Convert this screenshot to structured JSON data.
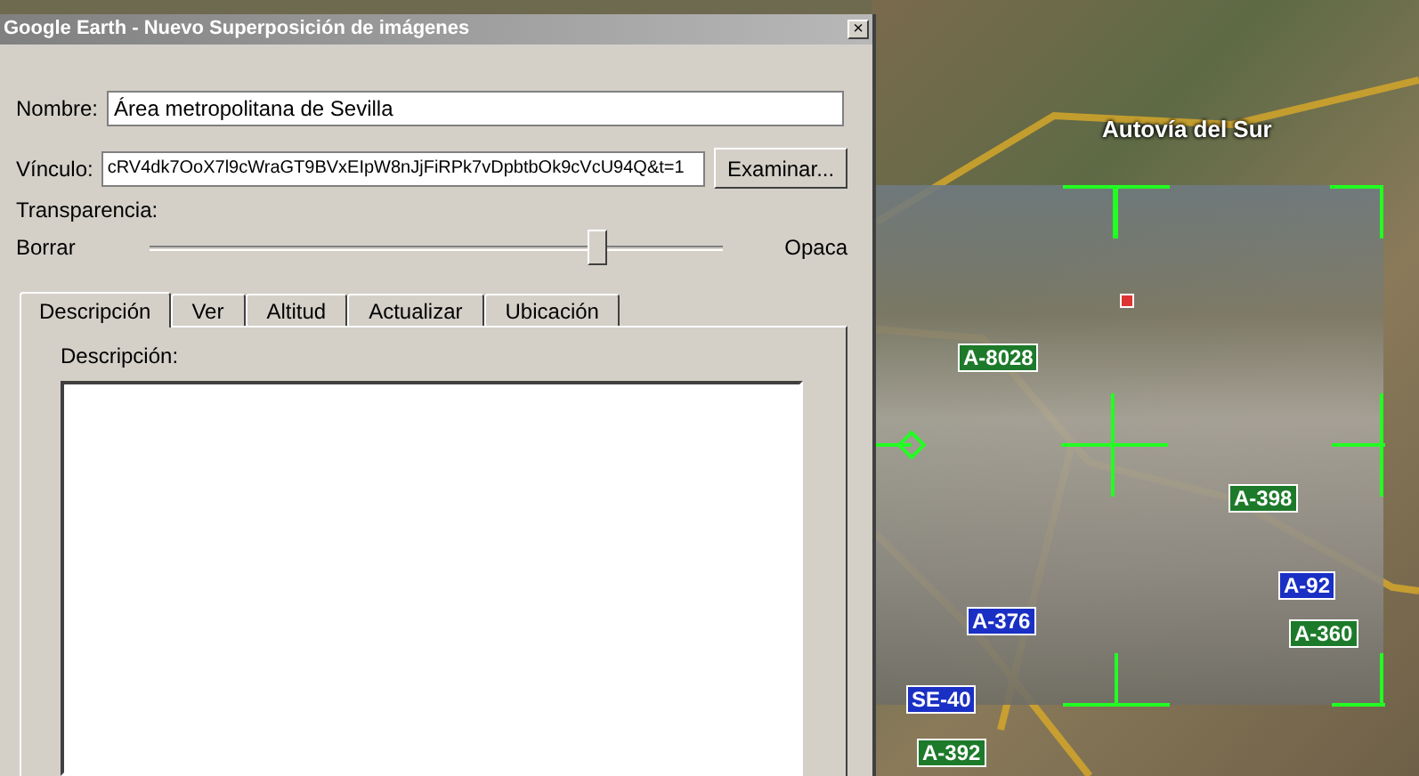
{
  "window": {
    "title": "Google Earth - Nuevo Superposición de imágenes",
    "close": "×"
  },
  "form": {
    "name_label": "Nombre:",
    "name_value": "Área metropolitana de Sevilla",
    "link_label": "Vínculo:",
    "link_value": "cRV4dk7OoX7l9cWraGT9BVxEIpW8nJjFiRPk7vDpbtbOk9cVcU94Q&t=1",
    "browse_button": "Examinar...",
    "transparency_label": "Transparencia:",
    "slider": {
      "min_label": "Borrar",
      "max_label": "Opaca",
      "level": 0.78
    }
  },
  "tabs": [
    {
      "label": "Descripción",
      "selected": true
    },
    {
      "label": "Ver",
      "selected": false
    },
    {
      "label": "Altitud",
      "selected": false
    },
    {
      "label": "Actualizar",
      "selected": false
    },
    {
      "label": "Ubicación",
      "selected": false
    }
  ],
  "description": {
    "label": "Descripción:"
  },
  "map": {
    "road_name": "Autovía del Sur",
    "shields": [
      {
        "label": "A-8028",
        "color": "#1d7a2a"
      },
      {
        "label": "A-398",
        "color": "#1d7a2a"
      },
      {
        "label": "A-92",
        "color": "#1a2fc4"
      },
      {
        "label": "A-376",
        "color": "#1a2fc4"
      },
      {
        "label": "A-360",
        "color": "#1d7a2a"
      },
      {
        "label": "SE-40",
        "color": "#1a2fc4"
      },
      {
        "label": "A-392",
        "color": "#1d7a2a"
      }
    ]
  }
}
